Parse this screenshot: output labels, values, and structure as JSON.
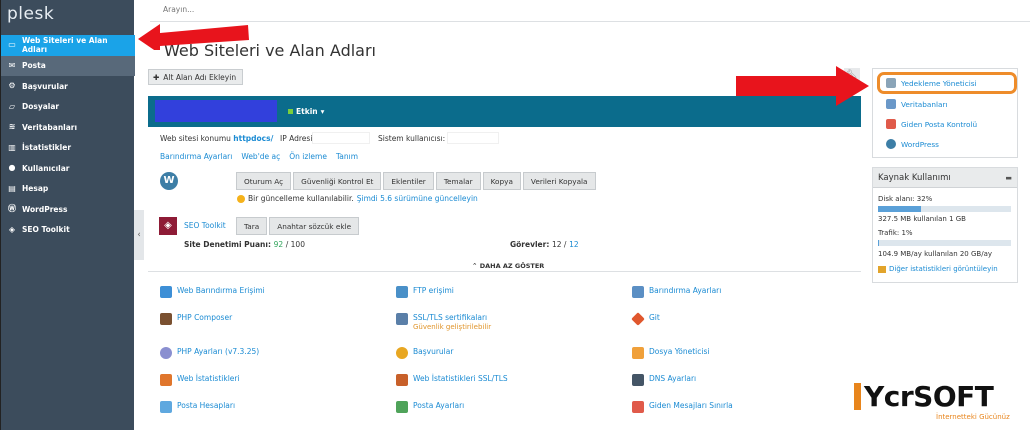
{
  "app": {
    "logo": "plesk"
  },
  "sidebar": {
    "items": [
      {
        "label": "Web Siteleri ve Alan Adları",
        "icon": "monitor-icon"
      },
      {
        "label": "Posta",
        "icon": "mail-icon"
      },
      {
        "label": "Başvurular",
        "icon": "gear-icon"
      },
      {
        "label": "Dosyalar",
        "icon": "folder-icon"
      },
      {
        "label": "Veritabanları",
        "icon": "layers-icon"
      },
      {
        "label": "İstatistikler",
        "icon": "stats-icon"
      },
      {
        "label": "Kullanıcılar",
        "icon": "user-icon"
      },
      {
        "label": "Hesap",
        "icon": "card-icon"
      },
      {
        "label": "WordPress",
        "icon": "wordpress-icon"
      },
      {
        "label": "SEO Toolkit",
        "icon": "seo-icon"
      }
    ]
  },
  "search": {
    "placeholder": "Arayın..."
  },
  "page": {
    "title": "Web Siteleri ve Alan Adları",
    "add_subdomain": "Alt Alan Adı Ekleyin"
  },
  "domain": {
    "status": "Etkin",
    "site_location_label": "Web sitesi konumu",
    "site_location_value": "httpdocs/",
    "ip_label": "IP Adresi:",
    "system_user_label": "Sistem kullanıcısı:",
    "links": [
      "Barındırma Ayarları",
      "Web'de aç",
      "Ön izleme",
      "Tanım"
    ],
    "wp_buttons": [
      "Oturum Aç",
      "Güvenliği Kontrol Et",
      "Eklentiler",
      "Temalar",
      "Kopya",
      "Verileri Kopyala"
    ],
    "update_text": "Bir güncelleme kullanılabilir.",
    "update_link": "Şimdi 5.6 sürümüne güncelleyin",
    "seo_label": "SEO Toolkit",
    "seo_buttons": [
      "Tara",
      "Anahtar sözcük ekle"
    ],
    "audit_label": "Site Denetimi Puanı:",
    "audit_score": "92",
    "audit_total": "/ 100",
    "tasks_label": "Görevler:",
    "tasks_done": "12 /",
    "tasks_total": "12",
    "show_less": "DAHA AZ GÖSTER"
  },
  "tools": [
    {
      "label": "Web Barındırma Erişimi",
      "icon_color": "#3d8fd6"
    },
    {
      "label": "FTP erişimi",
      "icon_color": "#4a90c8"
    },
    {
      "label": "Barındırma Ayarları",
      "icon_color": "#5b8fc4"
    },
    {
      "label": "PHP Composer",
      "icon_color": "#7a5030"
    },
    {
      "label": "SSL/TLS sertifikaları",
      "sub": "Güvenlik geliştirilebilir",
      "icon_color": "#5a7fa8"
    },
    {
      "label": "Git",
      "icon_color": "#e0572d"
    },
    {
      "label": "PHP Ayarları (v7.3.25)",
      "icon_color": "#8a8fd0"
    },
    {
      "label": "Başvurular",
      "icon_color": "#e8a722"
    },
    {
      "label": "Dosya Yöneticisi",
      "icon_color": "#f0a03a"
    },
    {
      "label": "Web İstatistikleri",
      "icon_color": "#e0762c"
    },
    {
      "label": "Web İstatistikleri SSL/TLS",
      "icon_color": "#c8602a"
    },
    {
      "label": "DNS Ayarları",
      "icon_color": "#445566"
    },
    {
      "label": "Posta Hesapları",
      "icon_color": "#5fa8df"
    },
    {
      "label": "Posta Ayarları",
      "icon_color": "#4fa35a"
    },
    {
      "label": "Giden Mesajları Sınırla",
      "icon_color": "#e05a4a"
    }
  ],
  "right_panel": {
    "items": [
      {
        "label": "Yedekleme Yöneticisi",
        "icon_color": "#8aa4b8"
      },
      {
        "label": "Veritabanları",
        "icon_color": "#6a98c8"
      },
      {
        "label": "Giden Posta Kontrolü",
        "icon_color": "#e05a4a"
      },
      {
        "label": "WordPress",
        "icon_color": "#3d7ea6"
      }
    ]
  },
  "resources": {
    "title": "Kaynak Kullanımı",
    "disk_label": "Disk alanı: 32%",
    "disk_fill": 0.32,
    "disk_detail": "327.5 MB kullanılan 1 GB",
    "traffic_label": "Trafik: 1%",
    "traffic_fill": 0.01,
    "traffic_detail": "104.9 MB/ay kullanılan 20 GB/ay",
    "more_link": "Diğer istatistikleri görüntüleyin"
  },
  "watermark": {
    "brand": "YcrSOFT",
    "tagline": "İnternetteki Gücünüz"
  },
  "colors": {
    "accent": "#1aa3e8",
    "header": "#0b6c8c",
    "sidebar": "#3c4c5c",
    "arrow": "#e8141c",
    "highlight": "#ee8c2a"
  }
}
